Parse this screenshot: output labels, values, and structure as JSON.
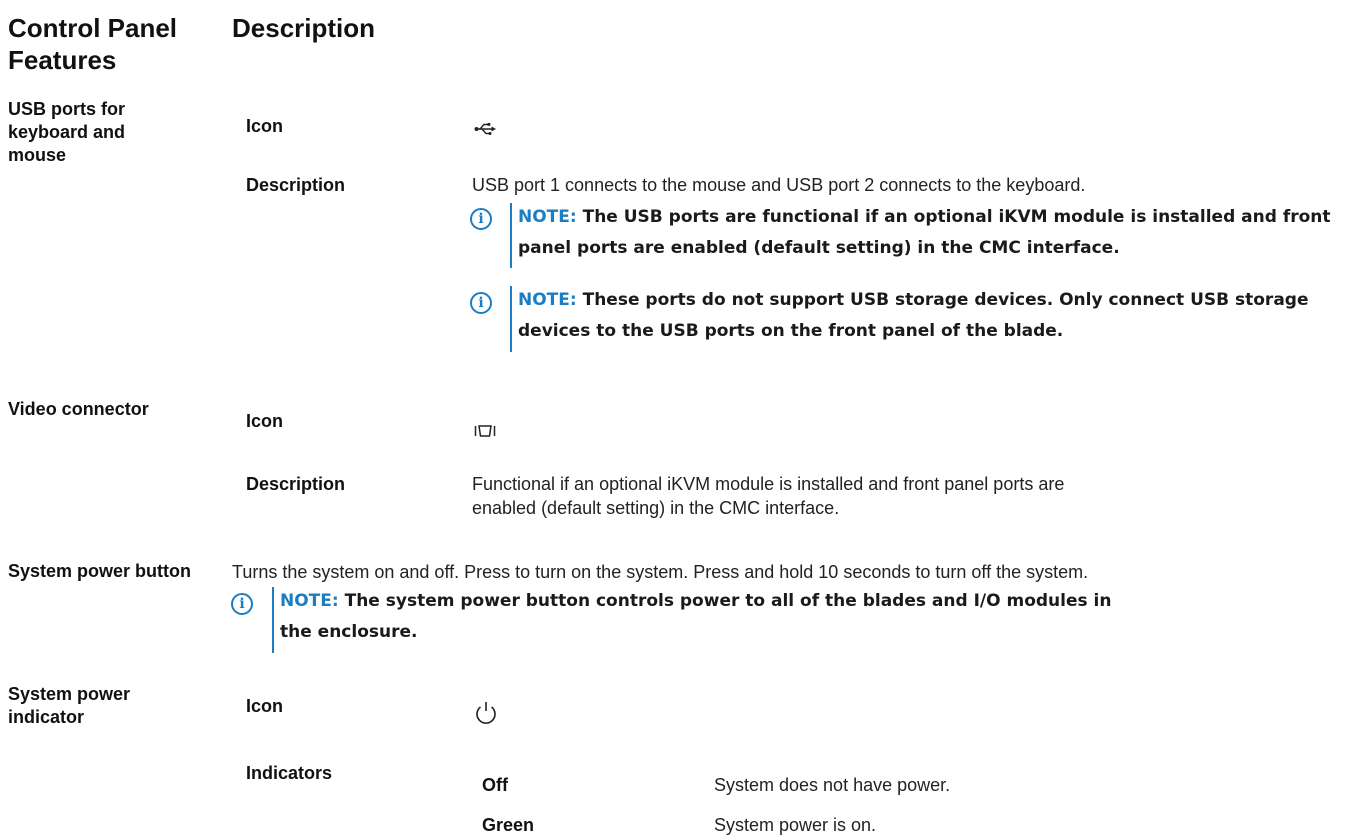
{
  "header": {
    "col1": "Control Panel Features",
    "col2": "Description"
  },
  "icons": {
    "note": "info-icon",
    "usb": "usb-icon",
    "video": "video-connector-icon",
    "power": "power-icon"
  },
  "colors": {
    "note_accent": "#1b7ec2"
  },
  "rows": {
    "usb": {
      "feature": "USB ports for keyboard and mouse",
      "icon_label": "Icon",
      "desc_label": "Description",
      "description": "USB port 1 connects to the mouse and USB port 2 connects to the keyboard.",
      "notes": [
        {
          "label": "NOTE:",
          "text": "The USB ports are functional if an optional iKVM module is installed and front panel ports are enabled (default setting) in the CMC interface."
        },
        {
          "label": "NOTE:",
          "text": "These ports do not support USB storage devices. Only connect USB storage devices to the USB ports on the front panel of the blade."
        }
      ]
    },
    "video": {
      "feature": "Video connector",
      "icon_label": "Icon",
      "desc_label": "Description",
      "description": "Functional if an optional iKVM module is installed and front panel ports are enabled (default setting) in the CMC interface."
    },
    "power_button": {
      "feature": "System power button",
      "description": "Turns the system on and off. Press to turn on the system. Press and hold 10 seconds to turn off the system.",
      "note": {
        "label": "NOTE:",
        "text": "The system power button controls power to all of the blades and I/O modules in the enclosure."
      }
    },
    "power_indicator": {
      "feature": "System power indicator",
      "icon_label": "Icon",
      "indicators_label": "Indicators",
      "states": [
        {
          "state": "Off",
          "meaning": "System does not have power."
        },
        {
          "state": "Green",
          "meaning": "System power is on."
        }
      ]
    }
  }
}
